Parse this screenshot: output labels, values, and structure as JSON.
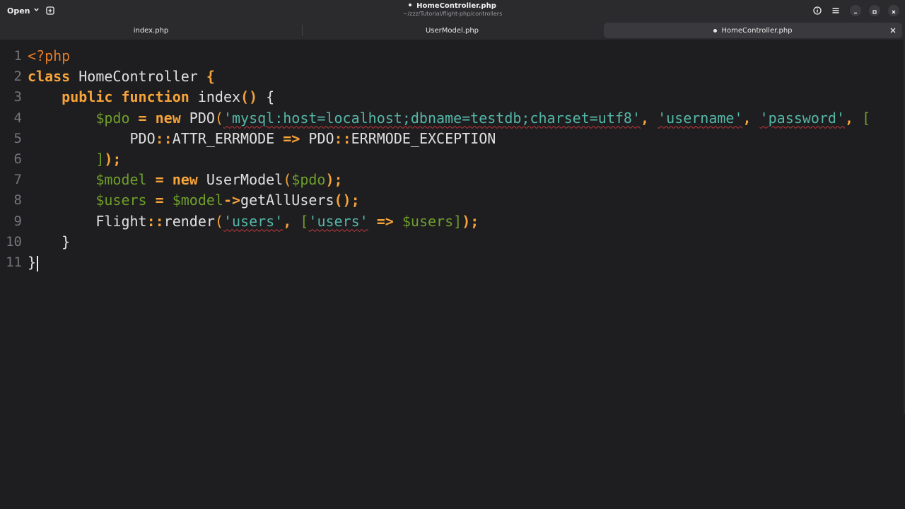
{
  "header": {
    "open_label": "Open",
    "title": "HomeController.php",
    "subtitle": "~/zzz/Tutorial/flight-php/controllers",
    "icons": [
      "info-icon",
      "hamburger-menu-icon",
      "minimize-icon",
      "maximize-icon",
      "close-icon"
    ]
  },
  "tabs": [
    {
      "label": "index.php"
    },
    {
      "label": "UserModel.php"
    },
    {
      "label": "HomeController.php",
      "active": true,
      "modified": true
    }
  ],
  "editor": {
    "line_numbers": [
      "1",
      "2",
      "3",
      "4",
      "5",
      "6",
      "7",
      "8",
      "9",
      "10",
      "11"
    ],
    "lines": [
      [
        {
          "t": "<?php",
          "c": "tag"
        }
      ],
      [
        {
          "t": "class",
          "c": "kw"
        },
        {
          "t": " HomeController ",
          "c": "name"
        },
        {
          "t": "{",
          "c": "op"
        }
      ],
      [
        {
          "t": "    ",
          "c": "name"
        },
        {
          "t": "public",
          "c": "kw"
        },
        {
          "t": " ",
          "c": "name"
        },
        {
          "t": "function",
          "c": "kw"
        },
        {
          "t": " index",
          "c": "name"
        },
        {
          "t": "()",
          "c": "op"
        },
        {
          "t": " {",
          "c": "name"
        }
      ],
      [
        {
          "t": "        ",
          "c": "name"
        },
        {
          "t": "$pdo",
          "c": "var"
        },
        {
          "t": " = ",
          "c": "op"
        },
        {
          "t": "new",
          "c": "kw"
        },
        {
          "t": " PDO",
          "c": "name"
        },
        {
          "t": "(",
          "c": "paren"
        },
        {
          "t": "'mysql:host=localhost;dbname=testdb;charset=utf8'",
          "c": "str"
        },
        {
          "t": ", ",
          "c": "op"
        },
        {
          "t": "'username'",
          "c": "str"
        },
        {
          "t": ", ",
          "c": "op"
        },
        {
          "t": "'password'",
          "c": "str"
        },
        {
          "t": ", ",
          "c": "op"
        },
        {
          "t": "[",
          "c": "brk"
        }
      ],
      [
        {
          "t": "            PDO",
          "c": "name"
        },
        {
          "t": "::",
          "c": "op"
        },
        {
          "t": "ATTR_ERRMODE ",
          "c": "name"
        },
        {
          "t": "=>",
          "c": "op"
        },
        {
          "t": " PDO",
          "c": "name"
        },
        {
          "t": "::",
          "c": "op"
        },
        {
          "t": "ERRMODE_EXCEPTION",
          "c": "name"
        }
      ],
      [
        {
          "t": "        ",
          "c": "name"
        },
        {
          "t": "]",
          "c": "brk"
        },
        {
          "t": ");",
          "c": "op"
        }
      ],
      [
        {
          "t": "        ",
          "c": "name"
        },
        {
          "t": "$model",
          "c": "var"
        },
        {
          "t": " = ",
          "c": "op"
        },
        {
          "t": "new",
          "c": "kw"
        },
        {
          "t": " UserModel",
          "c": "name"
        },
        {
          "t": "(",
          "c": "paren"
        },
        {
          "t": "$pdo",
          "c": "var"
        },
        {
          "t": ");",
          "c": "op"
        }
      ],
      [
        {
          "t": "        ",
          "c": "name"
        },
        {
          "t": "$users",
          "c": "var"
        },
        {
          "t": " = ",
          "c": "op"
        },
        {
          "t": "$model",
          "c": "var"
        },
        {
          "t": "->",
          "c": "op"
        },
        {
          "t": "getAllUsers",
          "c": "name"
        },
        {
          "t": "();",
          "c": "op"
        }
      ],
      [
        {
          "t": "        Flight",
          "c": "name"
        },
        {
          "t": "::",
          "c": "op"
        },
        {
          "t": "render",
          "c": "name"
        },
        {
          "t": "(",
          "c": "paren"
        },
        {
          "t": "'users'",
          "c": "str"
        },
        {
          "t": ", ",
          "c": "op"
        },
        {
          "t": "[",
          "c": "brk"
        },
        {
          "t": "'users'",
          "c": "str"
        },
        {
          "t": " ",
          "c": "name"
        },
        {
          "t": "=>",
          "c": "op"
        },
        {
          "t": " ",
          "c": "name"
        },
        {
          "t": "$users",
          "c": "var"
        },
        {
          "t": "]",
          "c": "brk"
        },
        {
          "t": ");",
          "c": "op"
        }
      ],
      [
        {
          "t": "    }",
          "c": "name"
        }
      ],
      [
        {
          "t": "}",
          "c": "name"
        }
      ]
    ],
    "cursor_line": 11
  }
}
